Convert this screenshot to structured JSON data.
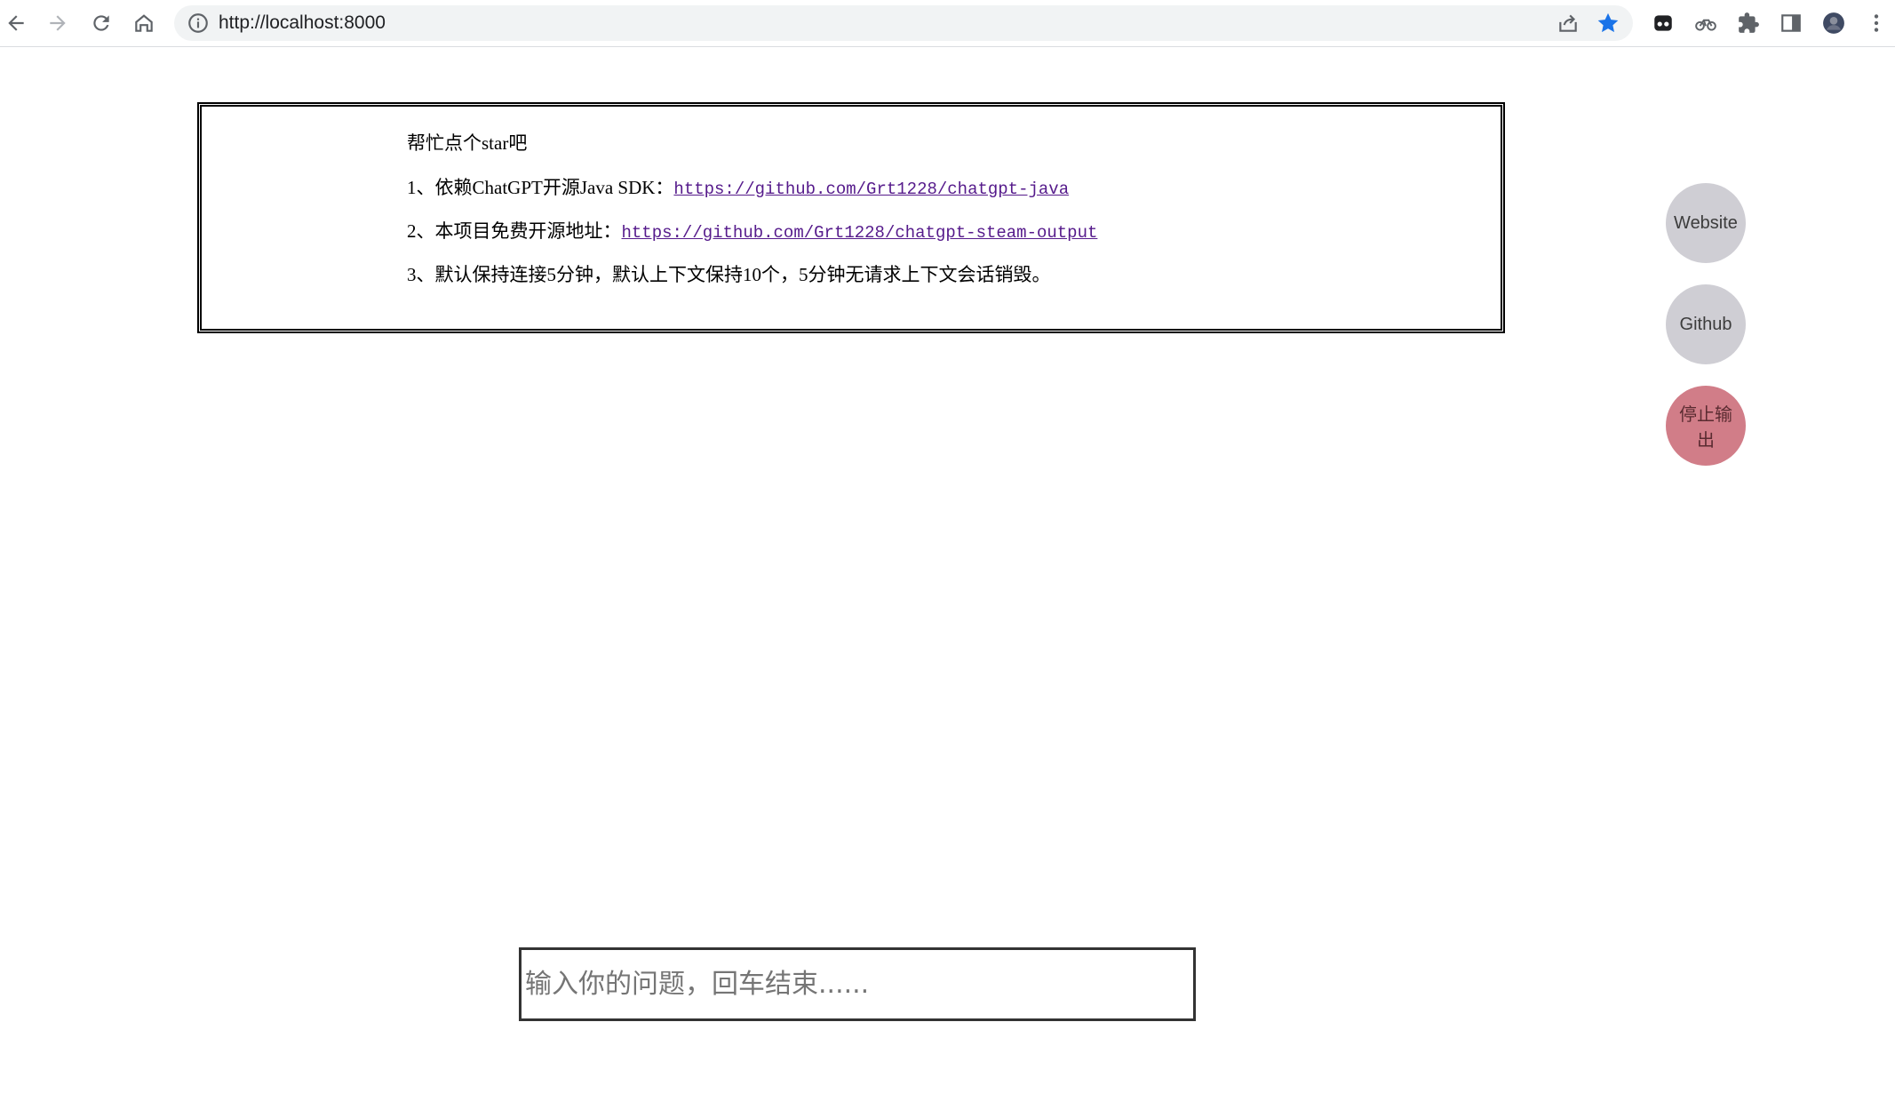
{
  "browser": {
    "url": "http://localhost:8000"
  },
  "notice": {
    "title": "帮忙点个star吧",
    "item1_prefix": "1、依赖ChatGPT开源Java SDK：",
    "item1_link": "https://github.com/Grt1228/chatgpt-java",
    "item2_prefix": "2、本项目免费开源地址：",
    "item2_link": "https://github.com/Grt1228/chatgpt-steam-output",
    "item3": "3、默认保持连接5分钟，默认上下文保持10个，5分钟无请求上下文会话销毁。"
  },
  "buttons": {
    "website": "Website",
    "github": "Github",
    "stop": "停止输出"
  },
  "input": {
    "placeholder": "输入你的问题，回车结束......",
    "value": ""
  },
  "colors": {
    "fab_gray": "#cfced4",
    "fab_stop": "#d17d88",
    "link": "#551a8b",
    "star": "#1a73e8"
  }
}
